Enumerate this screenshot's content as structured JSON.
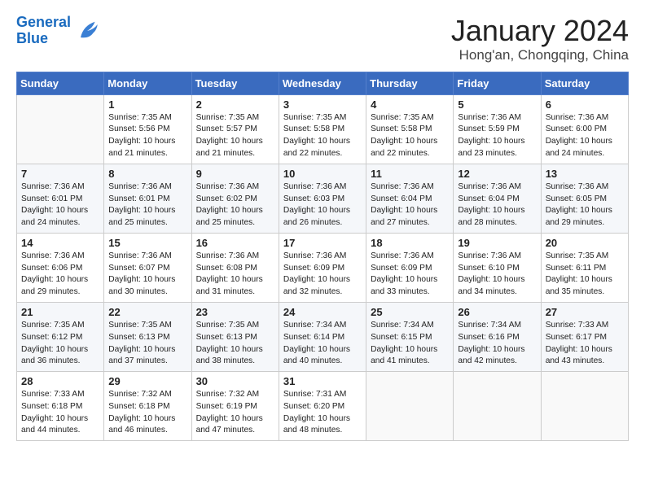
{
  "header": {
    "logo_line1": "General",
    "logo_line2": "Blue",
    "title": "January 2024",
    "subtitle": "Hong'an, Chongqing, China"
  },
  "days_of_week": [
    "Sunday",
    "Monday",
    "Tuesday",
    "Wednesday",
    "Thursday",
    "Friday",
    "Saturday"
  ],
  "weeks": [
    [
      {
        "day": "",
        "content": ""
      },
      {
        "day": "1",
        "content": "Sunrise: 7:35 AM\nSunset: 5:56 PM\nDaylight: 10 hours\nand 21 minutes."
      },
      {
        "day": "2",
        "content": "Sunrise: 7:35 AM\nSunset: 5:57 PM\nDaylight: 10 hours\nand 21 minutes."
      },
      {
        "day": "3",
        "content": "Sunrise: 7:35 AM\nSunset: 5:58 PM\nDaylight: 10 hours\nand 22 minutes."
      },
      {
        "day": "4",
        "content": "Sunrise: 7:35 AM\nSunset: 5:58 PM\nDaylight: 10 hours\nand 22 minutes."
      },
      {
        "day": "5",
        "content": "Sunrise: 7:36 AM\nSunset: 5:59 PM\nDaylight: 10 hours\nand 23 minutes."
      },
      {
        "day": "6",
        "content": "Sunrise: 7:36 AM\nSunset: 6:00 PM\nDaylight: 10 hours\nand 24 minutes."
      }
    ],
    [
      {
        "day": "7",
        "content": "Sunrise: 7:36 AM\nSunset: 6:01 PM\nDaylight: 10 hours\nand 24 minutes."
      },
      {
        "day": "8",
        "content": "Sunrise: 7:36 AM\nSunset: 6:01 PM\nDaylight: 10 hours\nand 25 minutes."
      },
      {
        "day": "9",
        "content": "Sunrise: 7:36 AM\nSunset: 6:02 PM\nDaylight: 10 hours\nand 25 minutes."
      },
      {
        "day": "10",
        "content": "Sunrise: 7:36 AM\nSunset: 6:03 PM\nDaylight: 10 hours\nand 26 minutes."
      },
      {
        "day": "11",
        "content": "Sunrise: 7:36 AM\nSunset: 6:04 PM\nDaylight: 10 hours\nand 27 minutes."
      },
      {
        "day": "12",
        "content": "Sunrise: 7:36 AM\nSunset: 6:04 PM\nDaylight: 10 hours\nand 28 minutes."
      },
      {
        "day": "13",
        "content": "Sunrise: 7:36 AM\nSunset: 6:05 PM\nDaylight: 10 hours\nand 29 minutes."
      }
    ],
    [
      {
        "day": "14",
        "content": "Sunrise: 7:36 AM\nSunset: 6:06 PM\nDaylight: 10 hours\nand 29 minutes."
      },
      {
        "day": "15",
        "content": "Sunrise: 7:36 AM\nSunset: 6:07 PM\nDaylight: 10 hours\nand 30 minutes."
      },
      {
        "day": "16",
        "content": "Sunrise: 7:36 AM\nSunset: 6:08 PM\nDaylight: 10 hours\nand 31 minutes."
      },
      {
        "day": "17",
        "content": "Sunrise: 7:36 AM\nSunset: 6:09 PM\nDaylight: 10 hours\nand 32 minutes."
      },
      {
        "day": "18",
        "content": "Sunrise: 7:36 AM\nSunset: 6:09 PM\nDaylight: 10 hours\nand 33 minutes."
      },
      {
        "day": "19",
        "content": "Sunrise: 7:36 AM\nSunset: 6:10 PM\nDaylight: 10 hours\nand 34 minutes."
      },
      {
        "day": "20",
        "content": "Sunrise: 7:35 AM\nSunset: 6:11 PM\nDaylight: 10 hours\nand 35 minutes."
      }
    ],
    [
      {
        "day": "21",
        "content": "Sunrise: 7:35 AM\nSunset: 6:12 PM\nDaylight: 10 hours\nand 36 minutes."
      },
      {
        "day": "22",
        "content": "Sunrise: 7:35 AM\nSunset: 6:13 PM\nDaylight: 10 hours\nand 37 minutes."
      },
      {
        "day": "23",
        "content": "Sunrise: 7:35 AM\nSunset: 6:13 PM\nDaylight: 10 hours\nand 38 minutes."
      },
      {
        "day": "24",
        "content": "Sunrise: 7:34 AM\nSunset: 6:14 PM\nDaylight: 10 hours\nand 40 minutes."
      },
      {
        "day": "25",
        "content": "Sunrise: 7:34 AM\nSunset: 6:15 PM\nDaylight: 10 hours\nand 41 minutes."
      },
      {
        "day": "26",
        "content": "Sunrise: 7:34 AM\nSunset: 6:16 PM\nDaylight: 10 hours\nand 42 minutes."
      },
      {
        "day": "27",
        "content": "Sunrise: 7:33 AM\nSunset: 6:17 PM\nDaylight: 10 hours\nand 43 minutes."
      }
    ],
    [
      {
        "day": "28",
        "content": "Sunrise: 7:33 AM\nSunset: 6:18 PM\nDaylight: 10 hours\nand 44 minutes."
      },
      {
        "day": "29",
        "content": "Sunrise: 7:32 AM\nSunset: 6:18 PM\nDaylight: 10 hours\nand 46 minutes."
      },
      {
        "day": "30",
        "content": "Sunrise: 7:32 AM\nSunset: 6:19 PM\nDaylight: 10 hours\nand 47 minutes."
      },
      {
        "day": "31",
        "content": "Sunrise: 7:31 AM\nSunset: 6:20 PM\nDaylight: 10 hours\nand 48 minutes."
      },
      {
        "day": "",
        "content": ""
      },
      {
        "day": "",
        "content": ""
      },
      {
        "day": "",
        "content": ""
      }
    ]
  ]
}
